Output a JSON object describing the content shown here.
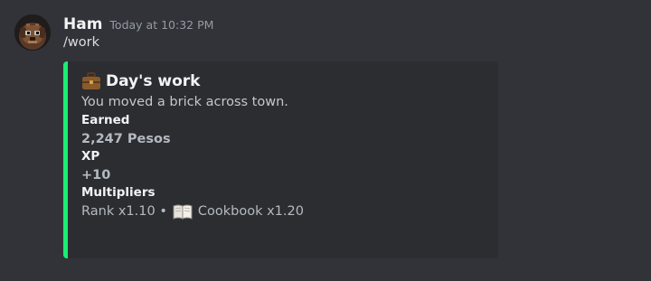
{
  "message": {
    "author": "Ham",
    "timestamp": "Today at 10:32 PM",
    "content": "/work",
    "avatar_icon": "pixel-dog-avatar"
  },
  "embed": {
    "accent_color": "#19ee74",
    "title_emoji": "briefcase-icon",
    "title": "Day's work",
    "description": "You moved a brick across town.",
    "fields": {
      "earned": {
        "name": "Earned",
        "value": "2,247 Pesos"
      },
      "xp": {
        "name": "XP",
        "value": "+10"
      },
      "multipliers": {
        "name": "Multipliers",
        "rank": "Rank x1.10 •",
        "book_emoji": "open-book-icon",
        "cookbook": "Cookbook x1.20"
      }
    }
  }
}
